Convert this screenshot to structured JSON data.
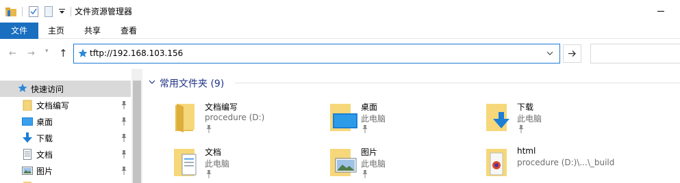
{
  "window": {
    "title": "文件资源管理器",
    "accent_color": "#1a6fc0"
  },
  "ribbon": {
    "tabs": [
      {
        "label": "文件",
        "active": true
      },
      {
        "label": "主页"
      },
      {
        "label": "共享"
      },
      {
        "label": "查看"
      }
    ]
  },
  "address": {
    "value": "tftp://192.168.103.156",
    "icon": "quick-access-star-icon"
  },
  "navpane": {
    "header": "快速访问",
    "items": [
      {
        "label": "文档编写",
        "icon": "folder-icon",
        "pinned": true
      },
      {
        "label": "桌面",
        "icon": "desktop-icon",
        "pinned": true
      },
      {
        "label": "下载",
        "icon": "download-icon",
        "pinned": true
      },
      {
        "label": "文档",
        "icon": "documents-icon",
        "pinned": true
      },
      {
        "label": "图片",
        "icon": "pictures-icon",
        "pinned": true
      }
    ]
  },
  "content": {
    "section_title": "常用文件夹 (9)",
    "folders": [
      {
        "name": "文档编写",
        "location": "procedure (D:)",
        "icon": "folder-icon",
        "pinned": true
      },
      {
        "name": "桌面",
        "location": "此电脑",
        "icon": "desktop-folder-icon",
        "pinned": true
      },
      {
        "name": "下载",
        "location": "此电脑",
        "icon": "downloads-folder-icon",
        "pinned": true
      },
      {
        "name": "文档",
        "location": "此电脑",
        "icon": "documents-folder-icon",
        "pinned": true
      },
      {
        "name": "图片",
        "location": "此电脑",
        "icon": "pictures-folder-icon",
        "pinned": true
      },
      {
        "name": "html",
        "location": "procedure (D:)\\...\\_build",
        "icon": "html-folder-icon",
        "pinned": false
      }
    ]
  }
}
